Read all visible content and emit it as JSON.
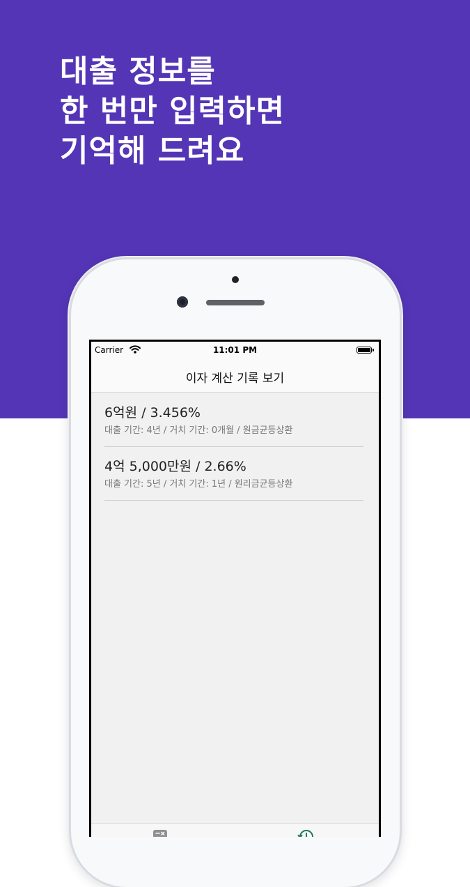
{
  "headline": {
    "line1": "대출 정보를",
    "line2": "한 번만 입력하면",
    "line3": "기억해 드려요"
  },
  "status_bar": {
    "carrier": "Carrier",
    "time": "11:01 PM"
  },
  "nav": {
    "title": "이자 계산 기록 보기"
  },
  "records": [
    {
      "title": "6억원 / 3.456%",
      "detail": "대출 기간: 4년 / 거치 기간: 0개월 / 원금균등상환"
    },
    {
      "title": "4억 5,000만원 / 2.66%",
      "detail": "대출 기간: 5년 / 거치 기간: 1년 / 원리금균등상환"
    }
  ],
  "tab_bar": {
    "tabs": [
      {
        "icon": "calculator-icon"
      },
      {
        "icon": "history-clock-icon",
        "selected": true
      }
    ]
  },
  "colors": {
    "hero_background": "#5435b6",
    "headline_text": "#ffffff",
    "selected_tab": "#1f7a5a"
  }
}
